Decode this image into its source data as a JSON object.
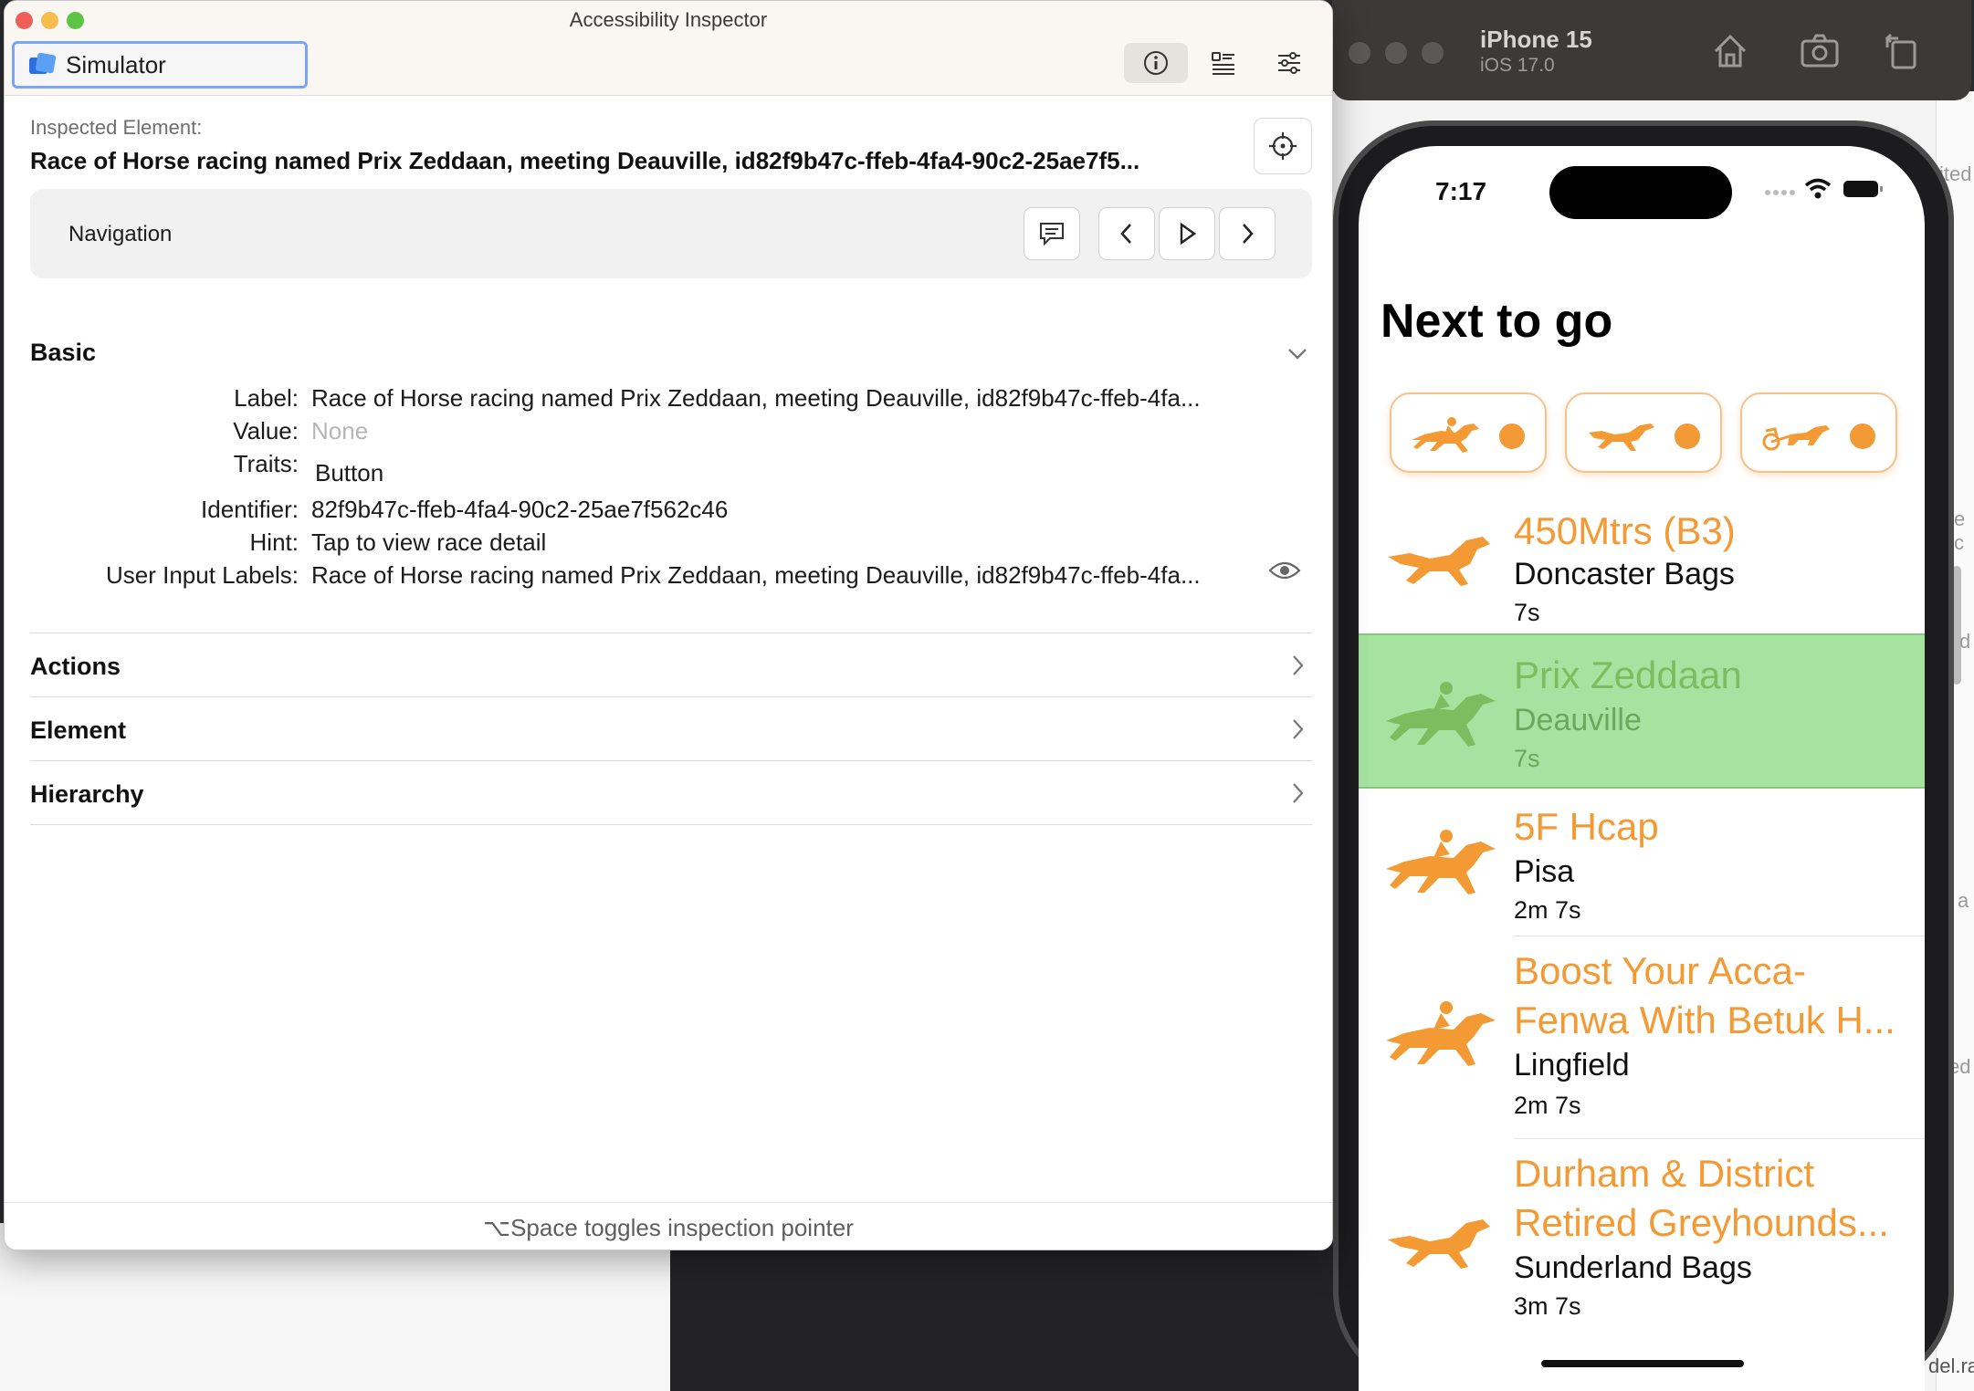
{
  "inspector": {
    "window_title": "Accessibility Inspector",
    "target": "Simulator",
    "inspected_label": "Inspected Element:",
    "element_title": "Race of Horse racing named Prix Zeddaan, meeting Deauville, id82f9b47c-ffeb-4fa4-90c2-25ae7f5...",
    "navigation_label": "Navigation",
    "basic": {
      "header": "Basic",
      "rows": [
        {
          "key": "Label:",
          "value": "Race of Horse racing named Prix Zeddaan, meeting Deauville, id82f9b47c-ffeb-4fa..."
        },
        {
          "key": "Value:",
          "value": "None"
        },
        {
          "key": "Traits:",
          "value": "Button"
        },
        {
          "key": "Identifier:",
          "value": "82f9b47c-ffeb-4fa4-90c2-25ae7f562c46"
        },
        {
          "key": "Hint:",
          "value": "Tap to view race detail"
        },
        {
          "key": "User Input Labels:",
          "value": "Race of Horse racing named Prix Zeddaan, meeting Deauville, id82f9b47c-ffeb-4fa..."
        }
      ]
    },
    "sections": [
      "Actions",
      "Element",
      "Hierarchy"
    ],
    "footer": "⌥Space toggles inspection pointer"
  },
  "simulator": {
    "device": "iPhone 15",
    "os": "iOS 17.0"
  },
  "phone": {
    "time": "7:17",
    "title": "Next to go",
    "races": [
      {
        "name": "450Mtrs (B3)",
        "venue": "Doncaster Bags",
        "time": "7s",
        "icon": "greyhound-icon",
        "selected": false
      },
      {
        "name": "Prix Zeddaan",
        "venue": "Deauville",
        "time": "7s",
        "icon": "horse-racing-icon",
        "selected": true
      },
      {
        "name": "5F Hcap",
        "venue": "Pisa",
        "time": "2m 7s",
        "icon": "horse-racing-icon",
        "selected": false
      },
      {
        "name": "Boost Your Acca-",
        "name2": "Fenwa With Betuk H...",
        "venue": "Lingfield",
        "time": "2m 7s",
        "icon": "horse-racing-icon",
        "selected": false
      },
      {
        "name": "Durham & District",
        "name2": "Retired Greyhounds...",
        "venue": "Sunderland Bags",
        "time": "3m 7s",
        "icon": "greyhound-icon",
        "selected": false
      }
    ],
    "accent": "#f39a34",
    "highlight": "#a7e3a0"
  },
  "background": {
    "right_fragments": [
      "ited",
      "d",
      "e c",
      "a",
      "ed",
      "del.ra"
    ]
  }
}
